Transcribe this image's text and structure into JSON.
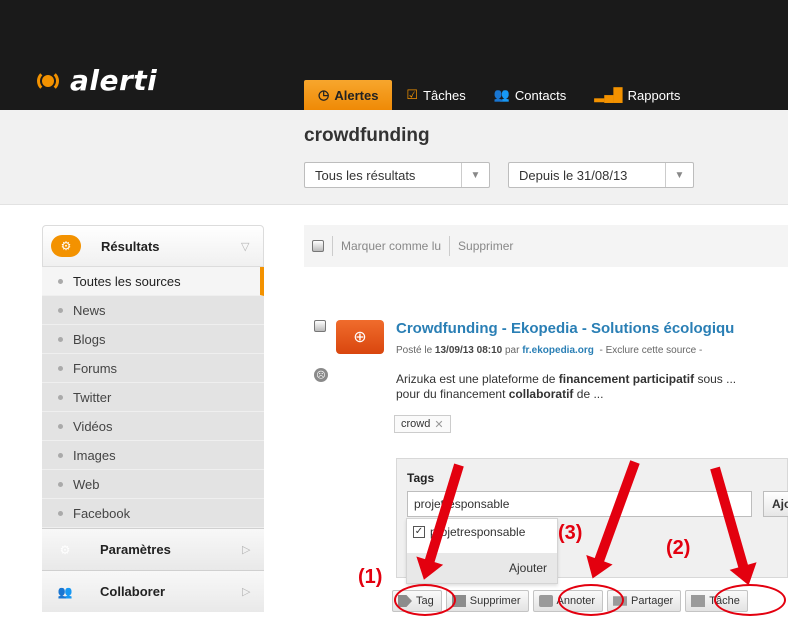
{
  "app": {
    "logo_text": "alerti"
  },
  "nav": {
    "tabs": [
      {
        "label": "Alertes",
        "icon": "clock-icon",
        "active": true
      },
      {
        "label": "Tâches",
        "icon": "check-icon",
        "active": false
      },
      {
        "label": "Contacts",
        "icon": "people-icon",
        "active": false
      },
      {
        "label": "Rapports",
        "icon": "bar-chart-icon",
        "active": false
      }
    ]
  },
  "header": {
    "title": "crowdfunding",
    "filter_results": "Tous les résultats",
    "filter_date": "Depuis le 31/08/13"
  },
  "sidebar": {
    "resultats_label": "Résultats",
    "items": [
      {
        "label": "Toutes les sources",
        "active": true
      },
      {
        "label": "News"
      },
      {
        "label": "Blogs"
      },
      {
        "label": "Forums"
      },
      {
        "label": "Twitter"
      },
      {
        "label": "Vidéos"
      },
      {
        "label": "Images"
      },
      {
        "label": "Web"
      },
      {
        "label": "Facebook"
      }
    ],
    "parametres_label": "Paramètres",
    "collaborer_label": "Collaborer"
  },
  "toolbar": {
    "mark_read": "Marquer comme lu",
    "delete": "Supprimer"
  },
  "result": {
    "title": "Crowdfunding - Ekopedia - Solutions écologiqu",
    "meta_prefix": "Posté le",
    "meta_date": "13/09/13 08:10",
    "meta_by": "par",
    "meta_source": "fr.ekopedia.org",
    "meta_exclude": "- Exclure cette source -",
    "excerpt_a": "Arizuka est une plateforme de ",
    "excerpt_b": "financement participatif",
    "excerpt_c": " sous ...",
    "excerpt_d": "pour du financement ",
    "excerpt_e": "collaboratif",
    "excerpt_f": " de ...",
    "tag_chip": "crowd"
  },
  "tags_panel": {
    "title": "Tags",
    "input_value": "projetresponsable",
    "add_button": "Ajo",
    "suggestion": "projetresponsable",
    "suggestion_add": "Ajouter"
  },
  "actions": [
    {
      "label": "Tag",
      "icon": "tag-icon"
    },
    {
      "label": "Supprimer",
      "icon": "delete-icon"
    },
    {
      "label": "Annoter",
      "icon": "comment-icon"
    },
    {
      "label": "Partager",
      "icon": "mail-icon"
    },
    {
      "label": "Tâche",
      "icon": "task-icon"
    }
  ],
  "annotations": {
    "n1": "(1)",
    "n2": "(2)",
    "n3": "(3)",
    "color": "#e3000f"
  },
  "colors": {
    "accent": "#f39200",
    "link": "#2a7fb5"
  }
}
